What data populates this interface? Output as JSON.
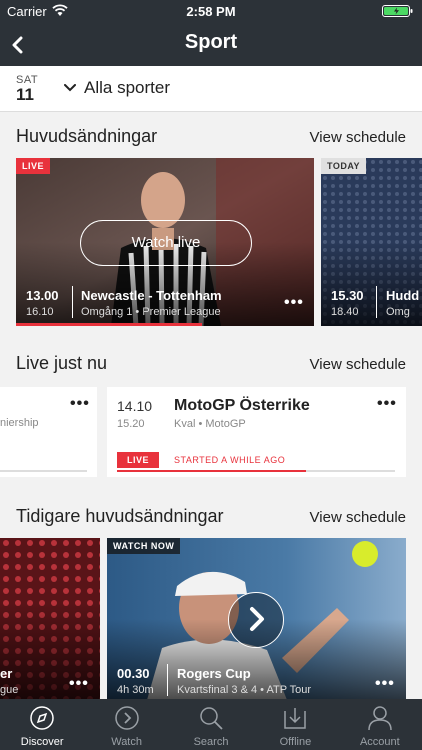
{
  "status": {
    "carrier": "Carrier",
    "time": "2:58 PM"
  },
  "nav": {
    "title": "Sport"
  },
  "datebar": {
    "day": "SAT",
    "date": "11",
    "filter": "Alla sporter"
  },
  "highlights": {
    "title": "Huvudsändningar",
    "link": "View schedule",
    "cards": [
      {
        "badge": "LIVE",
        "watch_label": "Watch live",
        "time_start": "13.00",
        "time_end": "16.10",
        "title": "Newcastle - Tottenham",
        "subtitle": "Omgång 1 • Premier League"
      },
      {
        "badge": "TODAY",
        "time_start": "15.30",
        "time_end": "18.40",
        "title": "Hudd",
        "subtitle": "Omg"
      }
    ]
  },
  "live_now": {
    "title": "Live just nu",
    "link": "View schedule",
    "cards": [
      {
        "subtitle": "niership"
      },
      {
        "time_start": "14.10",
        "time_end": "15.20",
        "title": "MotoGP Österrike",
        "subtitle": "Kval • MotoGP",
        "badge": "LIVE",
        "status": "STARTED A WHILE AGO",
        "progress": 0.68
      }
    ]
  },
  "earlier": {
    "title": "Tidigare huvudsändningar",
    "link": "View schedule",
    "cards": [
      {
        "title": "er",
        "subtitle": "gue"
      },
      {
        "badge": "WATCH NOW",
        "time_start": "00.30",
        "duration": "4h 30m",
        "title": "Rogers Cup",
        "subtitle": "Kvartsfinal 3 & 4 • ATP Tour"
      }
    ]
  },
  "tabbar": {
    "items": [
      {
        "label": "Discover",
        "icon": "compass-icon",
        "active": true
      },
      {
        "label": "Watch",
        "icon": "play-circle-icon"
      },
      {
        "label": "Search",
        "icon": "search-icon"
      },
      {
        "label": "Offline",
        "icon": "download-icon"
      },
      {
        "label": "Account",
        "icon": "person-icon"
      }
    ]
  },
  "colors": {
    "accent": "#e8323c",
    "bar": "#2c3238",
    "background": "#f2f2f2"
  }
}
